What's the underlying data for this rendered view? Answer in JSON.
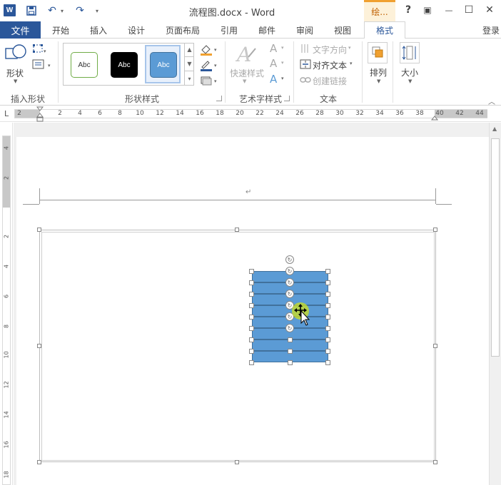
{
  "titlebar": {
    "title": "流程图.docx - Word",
    "context_tab": "绘...",
    "help": "?",
    "restore_ribbon": "▣",
    "minimize": "—",
    "maximize": "☐",
    "close": "✕",
    "undo": "↶",
    "redo": "↷",
    "customize": "▾"
  },
  "tabs": {
    "file": "文件",
    "items": [
      "开始",
      "插入",
      "设计",
      "页面布局",
      "引用",
      "邮件",
      "审阅",
      "视图",
      "格式"
    ],
    "login": "登录"
  },
  "ribbon": {
    "insert_shapes": {
      "shapes_label": "形状",
      "group": "插入形状"
    },
    "shape_styles": {
      "swatches": [
        "Abc",
        "Abc",
        "Abc"
      ],
      "group": "形状样式"
    },
    "wordart": {
      "quick_styles": "快速样式",
      "group": "艺术字样式"
    },
    "text": {
      "direction": "文字方向",
      "align": "对齐文本",
      "link": "创建链接",
      "group": "文本"
    },
    "arrange": {
      "label": "排列"
    },
    "size": {
      "label": "大小"
    }
  },
  "ruler": {
    "h_ticks": [
      "2",
      "2",
      "4",
      "6",
      "8",
      "10",
      "12",
      "14",
      "16",
      "18",
      "20",
      "22",
      "24",
      "26",
      "28",
      "30",
      "32",
      "34",
      "36",
      "38",
      "40",
      "42",
      "44"
    ],
    "v_ticks": [
      "4",
      "2",
      "2",
      "4",
      "6",
      "8",
      "10",
      "12",
      "14",
      "16",
      "18"
    ],
    "corner": "L"
  },
  "document": {
    "header_mark": "↵"
  },
  "colors": {
    "accent": "#2b579a",
    "shape_fill": "#5b9bd5",
    "shape_border": "#41719c",
    "context_accent": "#f0a030"
  }
}
